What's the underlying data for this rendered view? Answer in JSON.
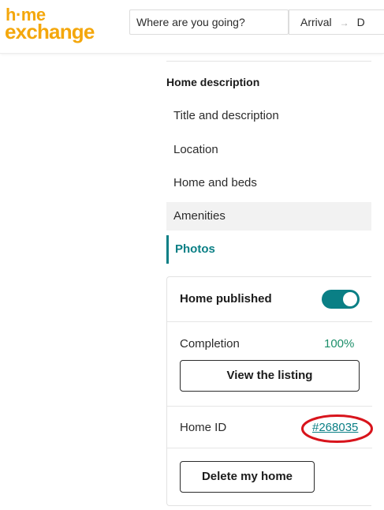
{
  "header": {
    "logo_line1": "h·me",
    "logo_line2": "exchange",
    "search": {
      "value": "Where are you going?"
    },
    "dates": {
      "arrival": "Arrival",
      "arrow": "→",
      "departure": "D"
    }
  },
  "sidebar": {
    "section_heading": "Home description",
    "items": [
      {
        "label": "Title and description"
      },
      {
        "label": "Location"
      },
      {
        "label": "Home and beds"
      },
      {
        "label": "Amenities"
      },
      {
        "label": "Photos"
      }
    ]
  },
  "card": {
    "published_label": "Home published",
    "published_on": true,
    "completion_label": "Completion",
    "completion_value": "100%",
    "view_listing_label": "View the listing",
    "home_id_label": "Home ID",
    "home_id_value": "#268035",
    "delete_label": "Delete my home"
  },
  "colors": {
    "brand": "#f4a70c",
    "accent": "#0a7f85",
    "completion": "#1d8f6a",
    "annotation": "#d8141c"
  },
  "icons": {
    "toggle": "toggle-switch-on",
    "dates_arrow": "arrow-right-icon"
  }
}
